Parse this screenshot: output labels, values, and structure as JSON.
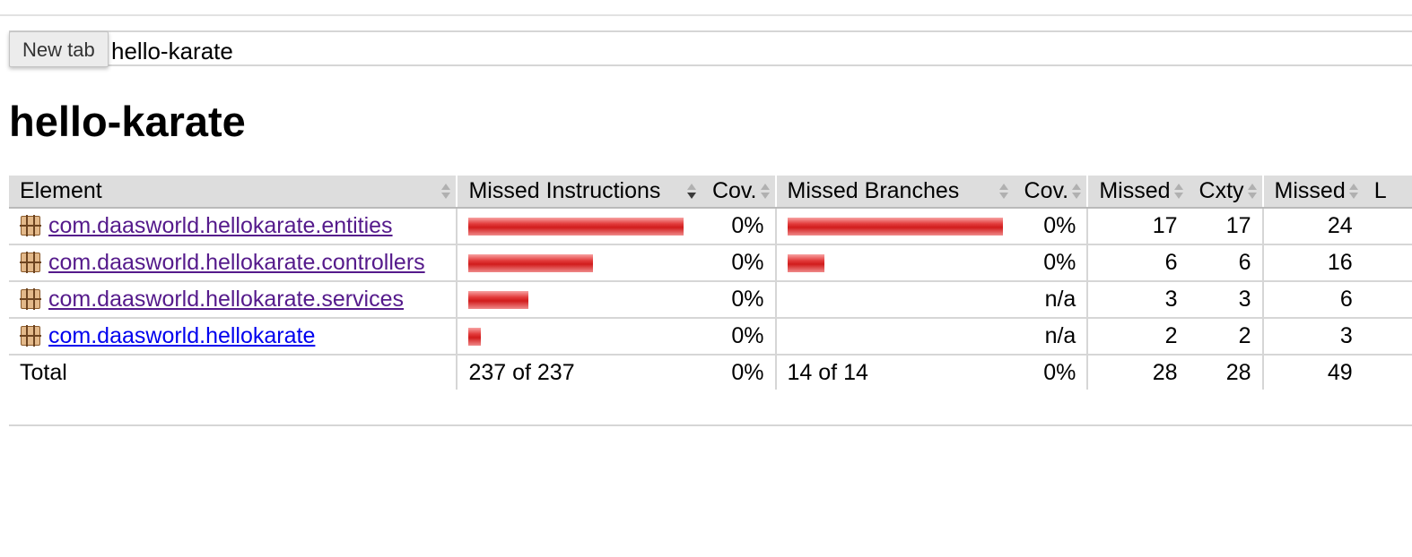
{
  "breadcrumb": {
    "text": "hello-karate"
  },
  "tooltip": {
    "label": "New tab"
  },
  "page_title": "hello-karate",
  "table": {
    "headers": {
      "element": "Element",
      "missed_instructions": "Missed Instructions",
      "cov_instructions": "Cov.",
      "missed_branches": "Missed Branches",
      "cov_branches": "Cov.",
      "missed_cxty": "Missed",
      "cxty": "Cxty",
      "missed_lines": "Missed",
      "lines": "L"
    },
    "rows": [
      {
        "element": "com.daasworld.hellokarate.entities",
        "link_state": "visited",
        "instructions_missed_fraction": 1.0,
        "cov_instructions": "0%",
        "branches_missed_fraction": 1.0,
        "cov_branches": "0%",
        "missed_cxty": "17",
        "cxty": "17",
        "missed_lines": "24"
      },
      {
        "element": "com.daasworld.hellokarate.controllers",
        "link_state": "visited",
        "instructions_missed_fraction": 0.58,
        "cov_instructions": "0%",
        "branches_missed_fraction": 0.17,
        "cov_branches": "0%",
        "missed_cxty": "6",
        "cxty": "6",
        "missed_lines": "16"
      },
      {
        "element": "com.daasworld.hellokarate.services",
        "link_state": "visited",
        "instructions_missed_fraction": 0.28,
        "cov_instructions": "0%",
        "branches_missed_fraction": 0,
        "cov_branches": "n/a",
        "missed_cxty": "3",
        "cxty": "3",
        "missed_lines": "6"
      },
      {
        "element": "com.daasworld.hellokarate",
        "link_state": "unvisited",
        "instructions_missed_fraction": 0.06,
        "cov_instructions": "0%",
        "branches_missed_fraction": 0,
        "cov_branches": "n/a",
        "missed_cxty": "2",
        "cxty": "2",
        "missed_lines": "3"
      }
    ],
    "total": {
      "label": "Total",
      "missed_instructions": "237 of 237",
      "cov_instructions": "0%",
      "missed_branches": "14 of 14",
      "cov_branches": "0%",
      "missed_cxty": "28",
      "cxty": "28",
      "missed_lines": "49"
    }
  },
  "colors": {
    "bar_red": "#d11c1c",
    "header_bg": "#dddddd",
    "visited_link": "#551a8b",
    "unvisited_link": "#0000ee"
  },
  "icons": {
    "package": "package-icon",
    "sort": "sort-icon"
  }
}
